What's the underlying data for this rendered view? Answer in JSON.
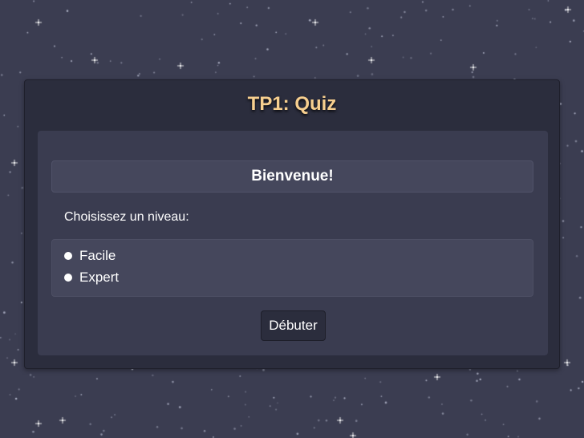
{
  "quiz": {
    "title": "TP1: Quiz",
    "welcome": "Bienvenue!",
    "prompt": "Choisissez un niveau:",
    "levels": [
      {
        "label": "Facile"
      },
      {
        "label": "Expert"
      }
    ],
    "start_label": "Débuter"
  },
  "colors": {
    "background": "#3b3d51",
    "card": "#2b2d3d",
    "panel": "#3a3c50",
    "title": "#f7cf8f",
    "text": "#ffffff"
  }
}
